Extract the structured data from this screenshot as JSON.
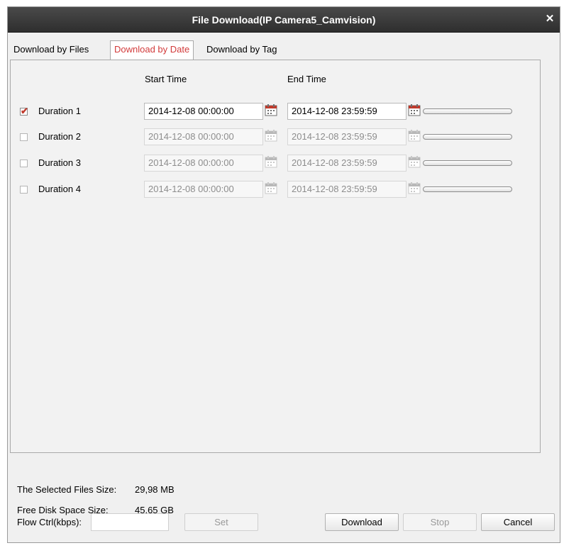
{
  "window": {
    "title": "File Download(IP Camera5_Camvision)"
  },
  "tabs": [
    {
      "label": "Download by Files"
    },
    {
      "label": "Download by Date",
      "active": true
    },
    {
      "label": "Download by Tag"
    }
  ],
  "columns": {
    "start": "Start Time",
    "end": "End Time"
  },
  "durations": [
    {
      "label": "Duration 1",
      "checked": true,
      "start": "2014-12-08 00:00:00",
      "end": "2014-12-08 23:59:59",
      "progress": 0
    },
    {
      "label": "Duration 2",
      "checked": false,
      "start": "2014-12-08 00:00:00",
      "end": "2014-12-08 23:59:59",
      "progress": 0
    },
    {
      "label": "Duration 3",
      "checked": false,
      "start": "2014-12-08 00:00:00",
      "end": "2014-12-08 23:59:59",
      "progress": 0
    },
    {
      "label": "Duration 4",
      "checked": false,
      "start": "2014-12-08 00:00:00",
      "end": "2014-12-08 23:59:59",
      "progress": 0
    }
  ],
  "info": {
    "selected_label": "The Selected Files Size:",
    "selected_value": "29,98 MB",
    "free_label": "Free Disk Space Size:",
    "free_value": "45,65 GB",
    "flow_label": "Flow Ctrl(kbps):",
    "flow_value": ""
  },
  "buttons": {
    "set": "Set",
    "download": "Download",
    "stop": "Stop",
    "cancel": "Cancel"
  },
  "colors": {
    "accent": "#d23b3b",
    "titlebar": "#3a3a3a"
  },
  "icons": {
    "close": "close-icon",
    "calendar": "calendar-icon"
  }
}
